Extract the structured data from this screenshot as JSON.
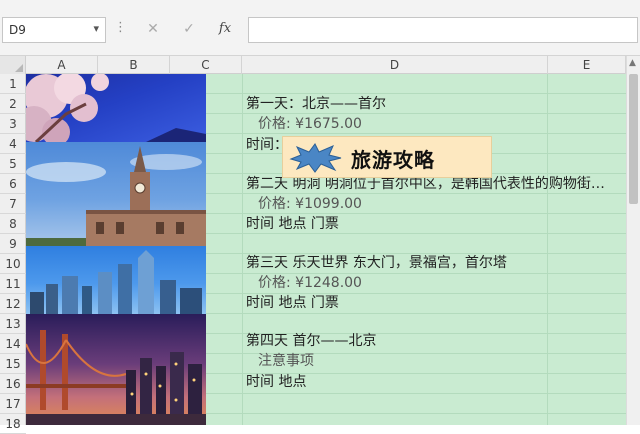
{
  "formula_bar": {
    "name_box": "D9",
    "name_box_arrow": "▾",
    "dots": "⋮",
    "cancel": "✕",
    "confirm": "✓",
    "fx": "fx",
    "formula": ""
  },
  "columns": [
    "A",
    "B",
    "C",
    "D",
    "E"
  ],
  "rows": [
    "1",
    "2",
    "3",
    "4",
    "5",
    "6",
    "7",
    "8",
    "9",
    "10",
    "11",
    "12",
    "13",
    "14",
    "15",
    "16",
    "17",
    "18"
  ],
  "cells": {
    "d2": "第一天：北京——首尔",
    "d3": "价格: ¥1675.00",
    "d4": "时间：",
    "d6": "第二天 明洞  明洞位于首尔中区，是韩国代表性的购物街…",
    "d7": "价格: ¥1099.00",
    "d8": "时间 地点 门票",
    "d10": "第三天 乐天世界 东大门，景福宫，首尔塔",
    "d11": "价格: ¥1248.00",
    "d12": "时间 地点 门票",
    "d14": "第四天 首尔——北京",
    "d15": "注意事项",
    "d16": "时间 地点"
  },
  "shape": {
    "title": "旅游攻略",
    "star_color": "#4a86c5",
    "fill": "#fde8c0"
  },
  "pictures": [
    "cherry-blossom-photo",
    "clock-tower-photo",
    "city-skyline-photo",
    "bridge-night-photo"
  ],
  "colors": {
    "sheet_fill": "#c9ebd1",
    "grid": "#b3dbbd"
  }
}
